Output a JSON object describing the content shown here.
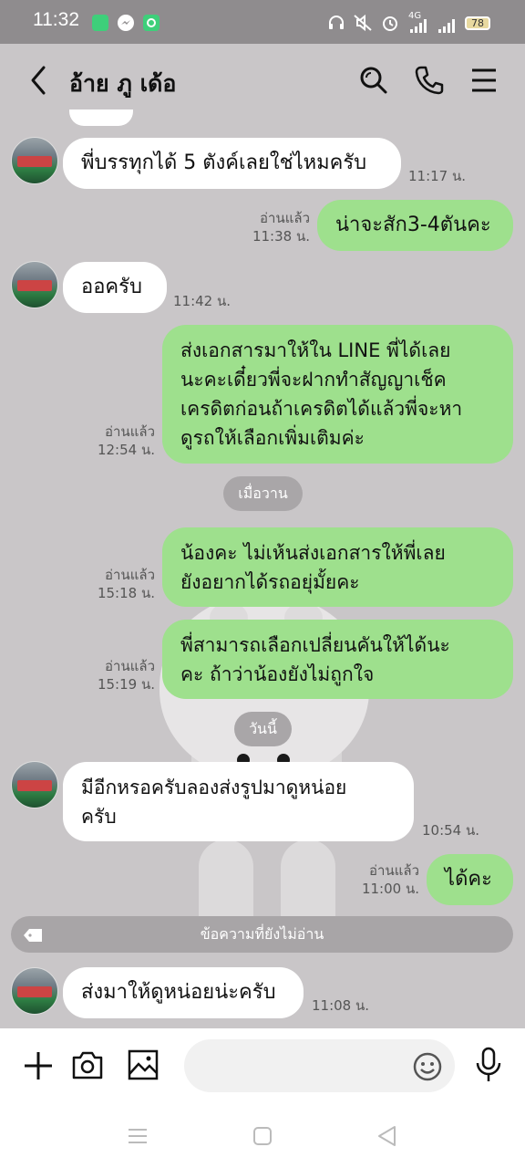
{
  "status_bar": {
    "time": "11:32",
    "battery": "78",
    "network": "4G",
    "icons": [
      "app-green-icon",
      "messenger-icon",
      "settings-app-icon",
      "headset-icon",
      "mute-icon",
      "alarm-icon",
      "signal-icon",
      "signal-icon",
      "battery-icon"
    ]
  },
  "header": {
    "title": "อ้าย ภู เด้อ",
    "icons": [
      "back-icon",
      "search-icon",
      "phone-icon",
      "menu-icon"
    ]
  },
  "messages": [
    {
      "dir": "in",
      "text": "พี่บรรทุกได้ 5 ตังค์เลยใช่ไหมครับ",
      "time": "11:17 น."
    },
    {
      "dir": "out",
      "text": "น่าจะสัก3-4ตันคะ",
      "read": "อ่านแล้ว",
      "time": "11:38 น."
    },
    {
      "dir": "in",
      "text": "ออครับ",
      "time": "11:42 น."
    },
    {
      "dir": "out",
      "lines": [
        "ส่งเอกสารมาให้ใน LINE พี่ได้เลย",
        "นะคะเดี๋ยวพี่จะฝากทำสัญญาเช็ค",
        "เครดิตก่อนถ้าเครดิตได้แล้วพี่จะหา",
        "ดูรถให้เลือกเพิ่มเติมค่ะ"
      ],
      "read": "อ่านแล้ว",
      "time": "12:54 น."
    },
    {
      "dir": "out",
      "lines": [
        "น้องคะ ไม่เห้นส่งเอกสารให้พี่เลย",
        "ยังอยากได้รถอยุ่มั้ยคะ"
      ],
      "read": "อ่านแล้ว",
      "time": "15:18 น."
    },
    {
      "dir": "out",
      "lines": [
        "พี่สามารถเลือกเปลี่ยนคันให้ได้นะ",
        "คะ ถ้าว่าน้องยังไม่ถูกใจ"
      ],
      "read": "อ่านแล้ว",
      "time": "15:19 น."
    },
    {
      "dir": "in",
      "lines": [
        "มีอีกหรอครับลองส่งรูปมาดูหน่อย",
        "ครับ"
      ],
      "time": "10:54 น."
    },
    {
      "dir": "out",
      "text": "ได้คะ",
      "read": "อ่านแล้ว",
      "time": "11:00 น."
    },
    {
      "dir": "in",
      "text": "ส่งมาให้ดูหน่อยน่ะครับ",
      "time": "11:08 น."
    }
  ],
  "date_dividers": [
    "เมื่อวาน",
    "วันนี้"
  ],
  "unread_divider": "ข้อความที่ยังไม่อ่าน",
  "input_bar": {
    "placeholder": "",
    "icons": [
      "plus-icon",
      "camera-icon",
      "image-icon",
      "emoji-icon",
      "microphone-icon"
    ]
  },
  "nav_bar": {
    "icons": [
      "recents-icon",
      "home-icon",
      "back-nav-icon"
    ]
  }
}
